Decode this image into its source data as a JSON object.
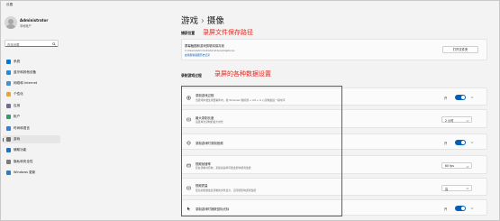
{
  "app": {
    "title": "设置"
  },
  "account": {
    "name": "Administrator",
    "type": "本地帐户"
  },
  "search": {
    "placeholder": "查找设置"
  },
  "nav": {
    "items": [
      {
        "label": "系统",
        "icon": "system-icon",
        "color": "#0078d4"
      },
      {
        "label": "蓝牙和其他设备",
        "icon": "bluetooth-icon",
        "color": "#2b88d8"
      },
      {
        "label": "网络和 Internet",
        "icon": "network-icon",
        "color": "#4a90c8"
      },
      {
        "label": "个性化",
        "icon": "brush-icon",
        "color": "#e8a33d"
      },
      {
        "label": "应用",
        "icon": "apps-icon",
        "color": "#6b6b9c"
      },
      {
        "label": "帐户",
        "icon": "account-icon",
        "color": "#2f9e6e"
      },
      {
        "label": "时间和语言",
        "icon": "clock-globe-icon",
        "color": "#3a7bd5"
      },
      {
        "label": "游戏",
        "icon": "game-controller-icon",
        "color": "#6e6e6e"
      },
      {
        "label": "辅助功能",
        "icon": "accessibility-icon",
        "color": "#1f6fc4"
      },
      {
        "label": "隐私和安全性",
        "icon": "shield-icon",
        "color": "#7a7a7a"
      },
      {
        "label": "Windows 更新",
        "icon": "update-icon",
        "color": "#1f7fd4"
      }
    ],
    "active_index": 7
  },
  "breadcrumb": {
    "parent": "游戏",
    "separator": "›",
    "current": "摄像"
  },
  "sections": {
    "capture_location": {
      "title": "捕获位置",
      "annotation": "录屏文件保存路径",
      "row_title": "屏幕截图和游戏剪辑将保存到",
      "path": "C:\\Users\\Administrator\\Videos\\Captures",
      "link": "启用屏幕截图历史记录",
      "button": "打开文件夹"
    },
    "recording": {
      "title": "录制游戏过程",
      "annotation": "录屏的各种数据设置",
      "rows": [
        {
          "icon": "record-icon",
          "title": "录制游戏过程",
          "desc": "当游戏中发生重要事件时，按 Windows 徽标键 + Alt + G 以录制最后一段时间",
          "control": "toggle",
          "value": "开"
        },
        {
          "icon": "timer-icon",
          "title": "最大录制长度",
          "desc": "设置单次录制的最大时长",
          "control": "select",
          "value": "2 小时"
        },
        {
          "icon": "mic-icon",
          "title": "录制游戏时录制音频",
          "desc": "",
          "control": "toggle",
          "value": "开"
        },
        {
          "icon": "video-icon",
          "title": "视频帧速率",
          "desc": "仅在录制时有效，某些帧速率可能会影响游戏性能",
          "control": "select",
          "value": "60 fps"
        },
        {
          "icon": "quality-icon",
          "title": "视频质量",
          "desc": "更高的质量会使录制的文件变大，且可能影响游戏性能",
          "control": "select",
          "value": "高"
        },
        {
          "icon": "cursor-icon",
          "title": "录制游戏时捕获鼠标光标",
          "desc": "",
          "control": "toggle",
          "value": "开"
        }
      ]
    }
  },
  "colors": {
    "accent": "#005fb8",
    "annotation": "#e8261b"
  }
}
